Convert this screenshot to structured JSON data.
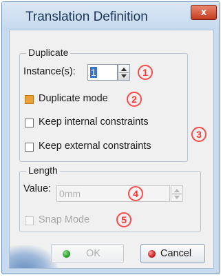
{
  "dialog": {
    "title": "Translation Definition",
    "close_glyph": "x"
  },
  "duplicate": {
    "legend": "Duplicate",
    "instances_label": "Instance(s):",
    "instances_value": "1",
    "duplicate_mode_label": "Duplicate mode",
    "keep_internal_label": "Keep internal constraints",
    "keep_external_label": "Keep external constraints"
  },
  "length": {
    "legend": "Length",
    "value_label": "Value:",
    "value": "0mm",
    "snap_mode_label": "Snap Mode"
  },
  "annotations": [
    "1",
    "2",
    "3",
    "4",
    "5"
  ],
  "buttons": {
    "ok_label": "OK",
    "cancel_label": "Cancel"
  },
  "colors": {
    "annotation_red": "#ff3535",
    "ok_dot": "#2aa02a",
    "cancel_dot": "#d21f1f",
    "duplicate_mode_checkbox": "#e9a23b"
  }
}
